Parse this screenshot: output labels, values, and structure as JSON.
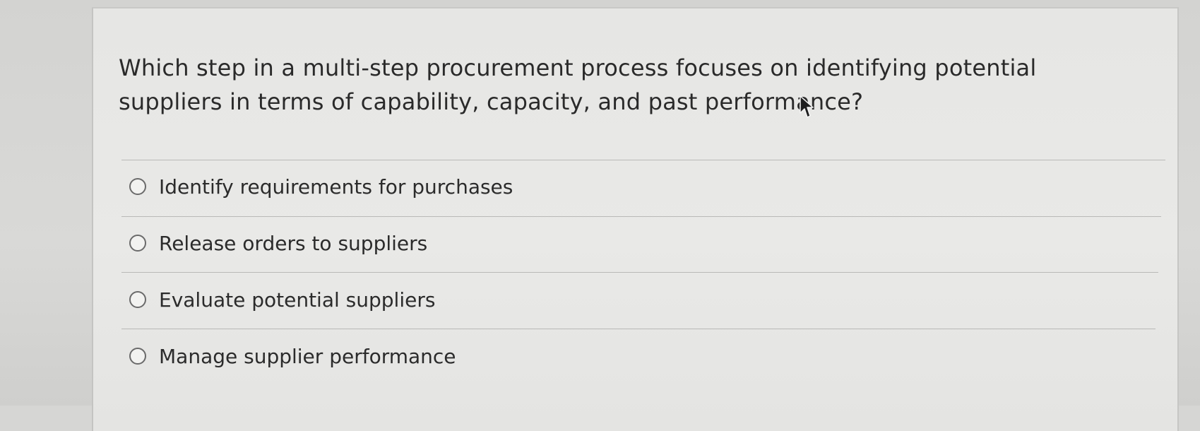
{
  "question": {
    "text": "Which step in a multi-step procurement process focuses on identifying potential suppliers in terms of capability, capacity, and past performance?"
  },
  "options": [
    {
      "label": "Identify requirements for purchases",
      "selected": false
    },
    {
      "label": "Release orders to suppliers",
      "selected": false
    },
    {
      "label": "Evaluate potential suppliers",
      "selected": false
    },
    {
      "label": "Manage supplier performance",
      "selected": false
    }
  ],
  "colors": {
    "text": "#2a2a2a",
    "card_background": "#e7e7e5",
    "divider": "#b9b9b7",
    "radio_border": "#6a6a6a"
  },
  "icons": {
    "cursor": "mouse-pointer-icon",
    "radio": "radio-button-icon"
  }
}
